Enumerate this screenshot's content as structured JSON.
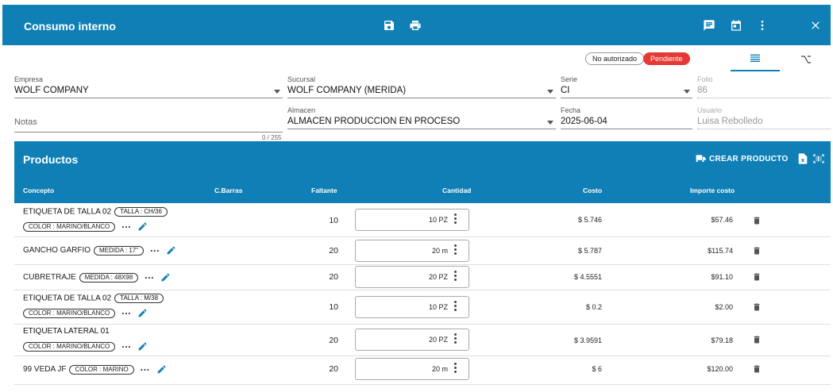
{
  "header": {
    "title": "Consumo interno"
  },
  "status": {
    "no_autorizado": "No autorizado",
    "pendiente": "Pendiente"
  },
  "form": {
    "empresa": {
      "label": "Empresa",
      "value": "WOLF COMPANY"
    },
    "sucursal": {
      "label": "Sucursal",
      "value": "WOLF COMPANY (MERIDA)"
    },
    "serie": {
      "label": "Serie",
      "value": "CI"
    },
    "folio": {
      "label": "Folio",
      "value": "86"
    },
    "notas": {
      "placeholder": "Notas",
      "counter": "0 / 255"
    },
    "almacen": {
      "label": "Almacen",
      "value": "ALMACEN PRODUCCION EN PROCESO"
    },
    "fecha": {
      "label": "Fecha",
      "value": "2025-06-04"
    },
    "usuario": {
      "label": "Usuario",
      "value": "Luisa Rebolledo"
    }
  },
  "productos": {
    "title": "Productos",
    "crear_label": "CREAR PRODUCTO",
    "columns": {
      "concepto": "Concepto",
      "cbarras": "C.Barras",
      "faltante": "Faltante",
      "cantidad": "Cantidad",
      "costo": "Costo",
      "importe": "Importe costo"
    },
    "rows": [
      {
        "name": "ETIQUETA DE TALLA 02",
        "chip1": "TALLA : CH/36",
        "chip2": "COLOR : MARINO/BLANCO",
        "faltante": "10",
        "cantidad": "10 PZ",
        "costo": "$ 5.746",
        "importe": "$57.46"
      },
      {
        "name": "GANCHO GARFIO",
        "chip1": "MEDIDA : 17\"",
        "chip2": "",
        "faltante": "20",
        "cantidad": "20 m",
        "costo": "$ 5.787",
        "importe": "$115.74"
      },
      {
        "name": "CUBRETRAJE",
        "chip1": "MEDIDA : 48X98",
        "chip2": "",
        "faltante": "20",
        "cantidad": "20 PZ",
        "costo": "$ 4.5551",
        "importe": "$91.10"
      },
      {
        "name": "ETIQUETA DE TALLA 02",
        "chip1": "TALLA : M/38",
        "chip2": "COLOR : MARINO/BLANCO",
        "faltante": "10",
        "cantidad": "10 PZ",
        "costo": "$ 0.2",
        "importe": "$2.00"
      },
      {
        "name": "ETIQUETA LATERAL 01",
        "chip1": "",
        "chip2": "COLOR : MARINO/BLANCO",
        "faltante": "20",
        "cantidad": "20 PZ",
        "costo": "$ 3.9591",
        "importe": "$79.18"
      },
      {
        "name": "99 VEDA JF",
        "chip1": "COLOR : MARINO",
        "chip2": "",
        "faltante": "20",
        "cantidad": "20 m",
        "costo": "$ 6",
        "importe": "$120.00"
      }
    ]
  }
}
